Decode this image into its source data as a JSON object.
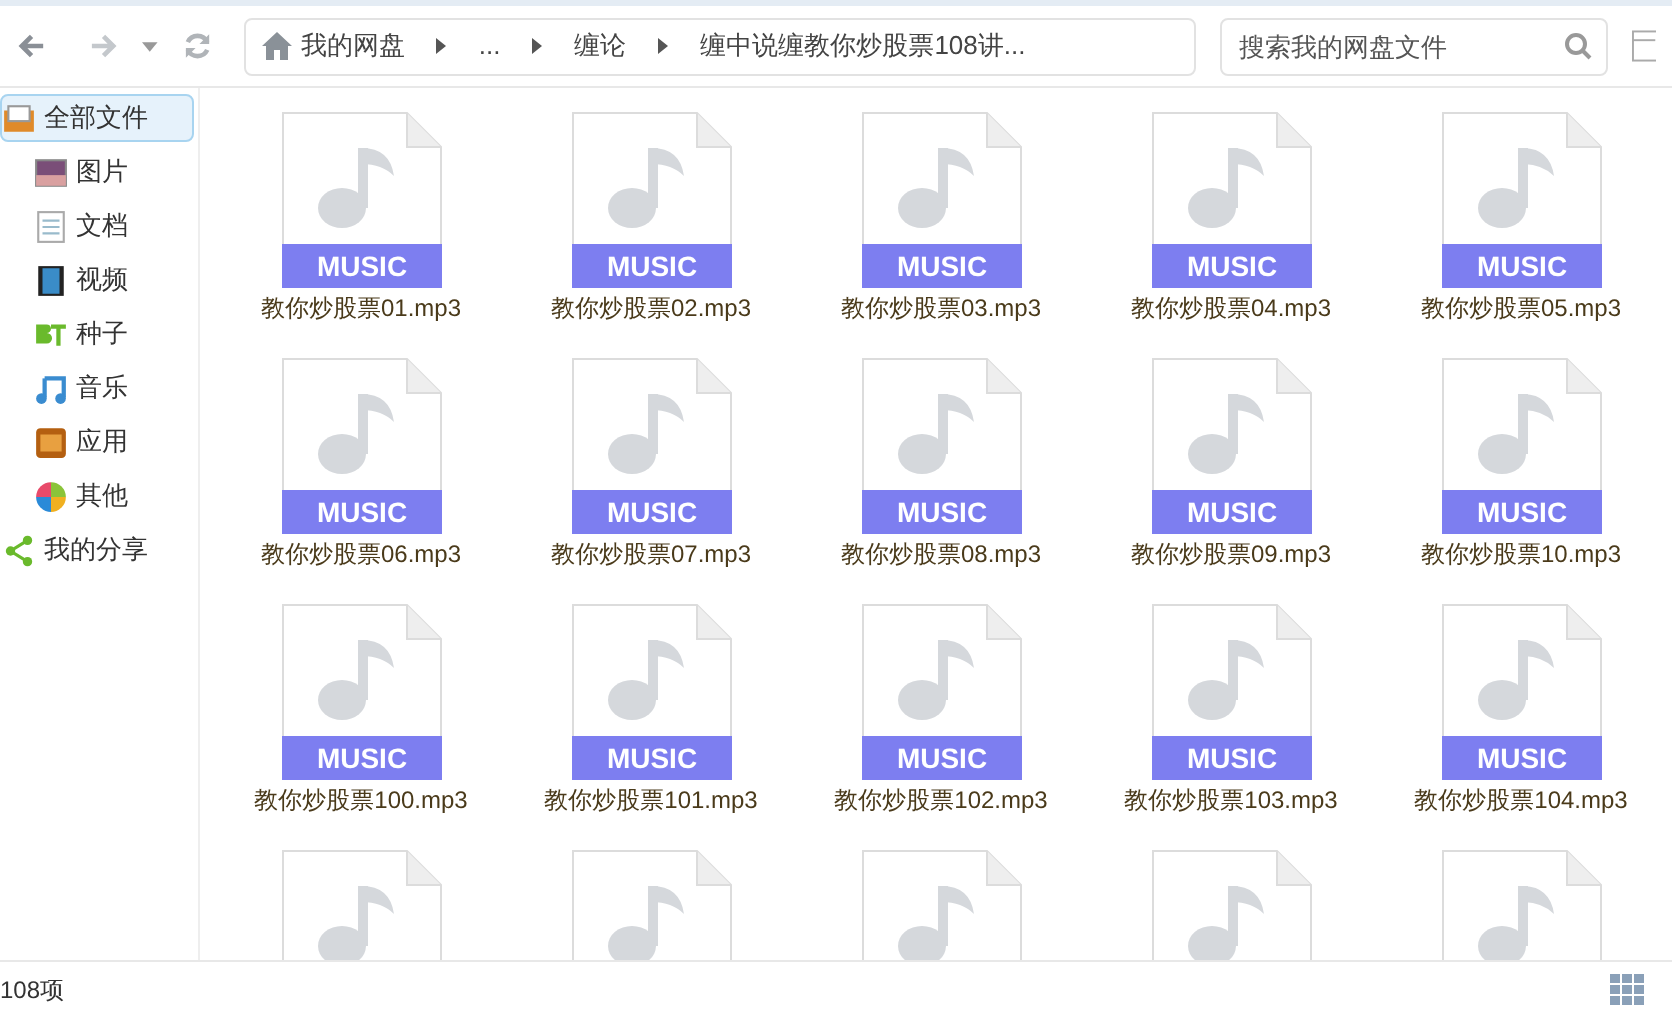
{
  "toolbar": {
    "breadcrumb": [
      {
        "label": "我的网盘"
      },
      {
        "label": "..."
      },
      {
        "label": "缠论"
      },
      {
        "label": "缠中说缠教你炒股票108讲..."
      }
    ],
    "search": {
      "placeholder": "搜索我的网盘文件"
    }
  },
  "sidebar": {
    "items": [
      {
        "label": "全部文件",
        "kind": "all",
        "selected": true
      },
      {
        "label": "图片",
        "kind": "picture",
        "selected": false
      },
      {
        "label": "文档",
        "kind": "doc",
        "selected": false
      },
      {
        "label": "视频",
        "kind": "video",
        "selected": false
      },
      {
        "label": "种子",
        "kind": "bt",
        "selected": false
      },
      {
        "label": "音乐",
        "kind": "music",
        "selected": false
      },
      {
        "label": "应用",
        "kind": "app",
        "selected": false
      },
      {
        "label": "其他",
        "kind": "other",
        "selected": false
      },
      {
        "label": "我的分享",
        "kind": "share",
        "selected": false
      }
    ]
  },
  "files": [
    {
      "kind": "file",
      "badge": "MUSIC",
      "name": "教你炒股票01.mp3"
    },
    {
      "kind": "file",
      "badge": "MUSIC",
      "name": "教你炒股票02.mp3"
    },
    {
      "kind": "file",
      "badge": "MUSIC",
      "name": "教你炒股票03.mp3"
    },
    {
      "kind": "file",
      "badge": "MUSIC",
      "name": "教你炒股票04.mp3"
    },
    {
      "kind": "file",
      "badge": "MUSIC",
      "name": "教你炒股票05.mp3"
    },
    {
      "kind": "file",
      "badge": "MUSIC",
      "name": "教你炒股票06.mp3"
    },
    {
      "kind": "file",
      "badge": "MUSIC",
      "name": "教你炒股票07.mp3"
    },
    {
      "kind": "file",
      "badge": "MUSIC",
      "name": "教你炒股票08.mp3"
    },
    {
      "kind": "file",
      "badge": "MUSIC",
      "name": "教你炒股票09.mp3"
    },
    {
      "kind": "file",
      "badge": "MUSIC",
      "name": "教你炒股票10.mp3"
    },
    {
      "kind": "file",
      "badge": "MUSIC",
      "name": "教你炒股票100.mp3"
    },
    {
      "kind": "file",
      "badge": "MUSIC",
      "name": "教你炒股票101.mp3"
    },
    {
      "kind": "file",
      "badge": "MUSIC",
      "name": "教你炒股票102.mp3"
    },
    {
      "kind": "file",
      "badge": "MUSIC",
      "name": "教你炒股票103.mp3"
    },
    {
      "kind": "file",
      "badge": "MUSIC",
      "name": "教你炒股票104.mp3"
    },
    {
      "kind": "partial"
    },
    {
      "kind": "partial"
    },
    {
      "kind": "partial"
    },
    {
      "kind": "partial"
    },
    {
      "kind": "partial"
    }
  ],
  "status_bar": {
    "count": "108项"
  }
}
